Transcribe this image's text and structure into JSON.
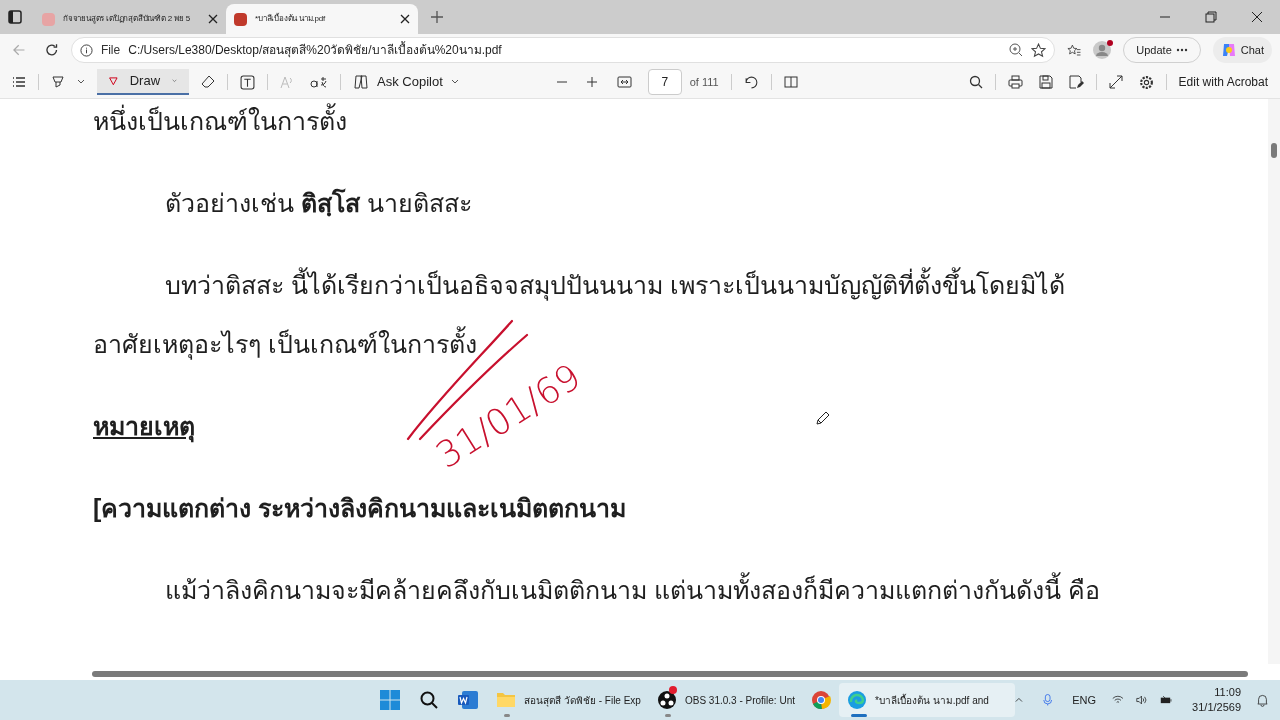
{
  "tabs": [
    {
      "title": "กัจจายนสูตร เตปิฏกสุตสีบัณฑิต 2 พย 5",
      "selected": false
    },
    {
      "title": "*บาลีเบื้องต้น นาม.pdf",
      "selected": true
    }
  ],
  "address_bar": {
    "scheme": "File",
    "url": "C:/Users/Le380/Desktop/สอนสุตสี%20วัดพิชัย/บาลีเบื้องต้น%20นาม.pdf"
  },
  "browser_buttons": {
    "update": "Update",
    "chat": "Chat"
  },
  "pdf_toolbar": {
    "draw": "Draw",
    "ask_copilot": "Ask Copilot",
    "page": "7",
    "page_total": "of 111",
    "edit": "Edit with Acrobat"
  },
  "document": {
    "lines": [
      {
        "kind": "body",
        "text": "หนึ่งเป็นเกณฑ์ในการตั้ง"
      },
      {
        "kind": "indented",
        "text": "ตัวอย่างเช่น **ติสฺโส** นายติสสะ"
      },
      {
        "kind": "indented_wrapped",
        "text": "บทว่าติสสะ นี้ได้เรียกว่าเป็นอธิจจสมุปปันนนาม เพราะเป็นนามบัญญัติที่ตั้งขึ้นโดยมิได้"
      },
      {
        "kind": "body",
        "text": "อาศัยเหตุอะไรๆ เป็นเกณฑ์ในการตั้ง"
      },
      {
        "kind": "underlined",
        "text": "หมายเหตุ"
      },
      {
        "kind": "bold",
        "text": "[ความแตกต่าง ระหว่างลิงคิกนามและเนมิตตกนาม"
      },
      {
        "kind": "indented",
        "text": "แม้ว่าลิงคิกนามจะมีคล้ายคลึงกับเนมิตติกนาม แต่นามทั้งสองก็มีความแตกต่างกันดังนี้ คือ"
      }
    ],
    "annotation": {
      "text": "31/01/69",
      "color": "#c8102e"
    }
  },
  "taskbar": {
    "apps": [
      {
        "kind": "explorer",
        "label": "สอนสุตสี วัดพิชัย - File Exp",
        "selected": false
      },
      {
        "kind": "obs",
        "label": "OBS 31.0.3 - Profile: Unt",
        "selected": false
      },
      {
        "kind": "chrome",
        "selected": false
      },
      {
        "kind": "edge",
        "label": "*บาลีเบื้องต้น นาม.pdf and",
        "selected": true
      }
    ],
    "language": "ENG",
    "time": "11:09",
    "date": "31/1/2569"
  }
}
